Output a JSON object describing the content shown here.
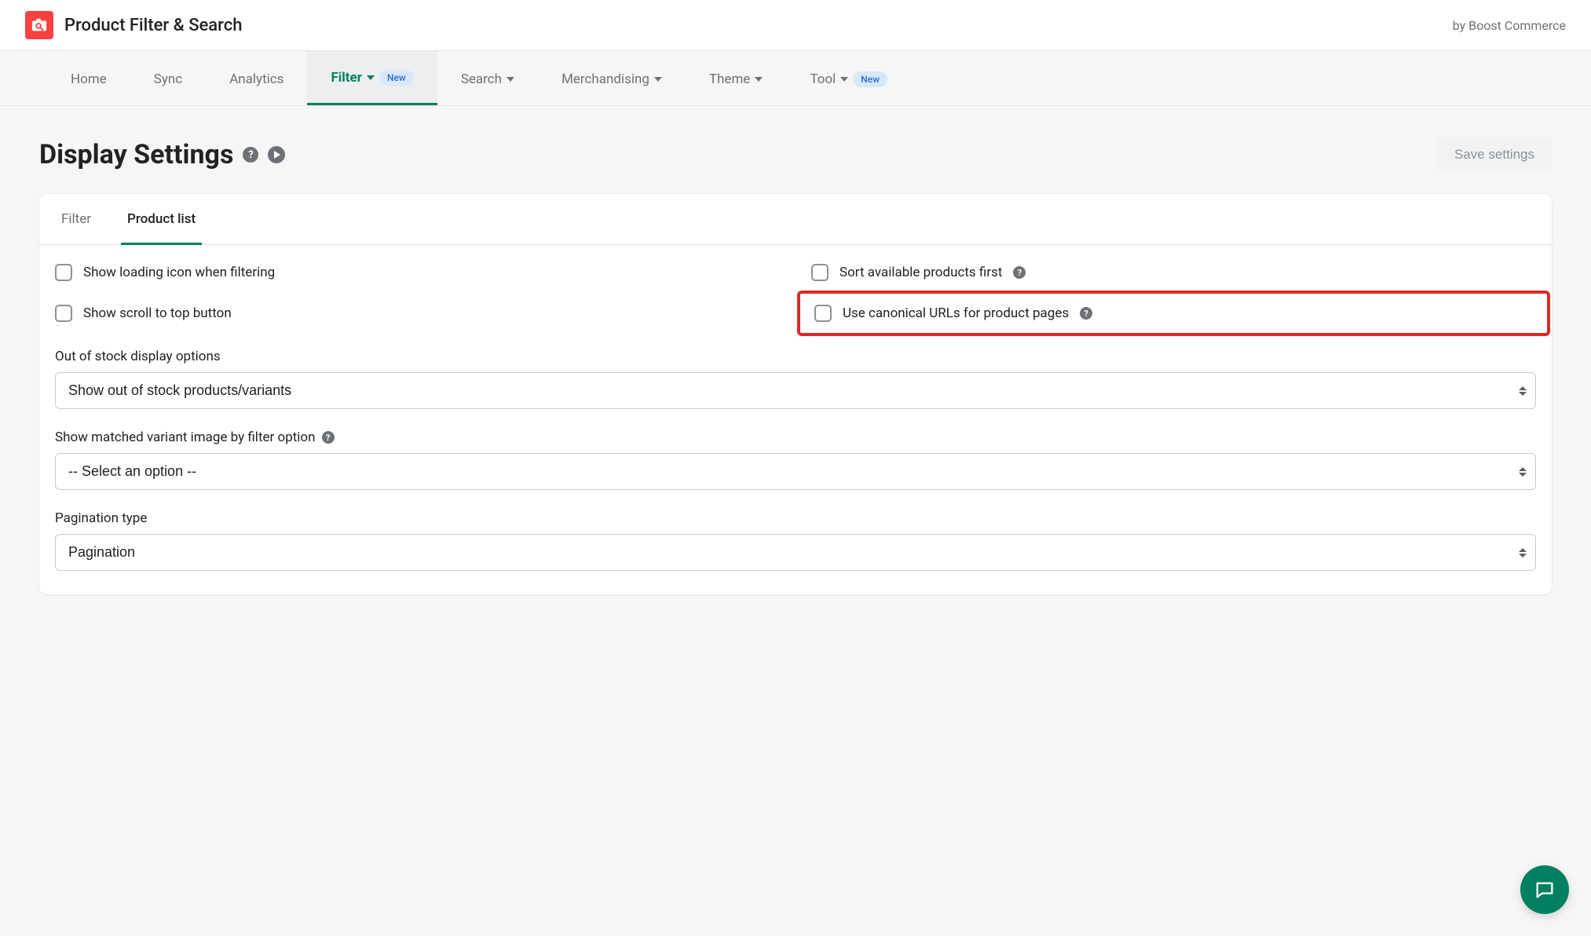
{
  "header": {
    "app_title": "Product Filter & Search",
    "by_line": "by Boost Commerce"
  },
  "nav": {
    "items": [
      {
        "label": "Home",
        "caret": false
      },
      {
        "label": "Sync",
        "caret": false
      },
      {
        "label": "Analytics",
        "caret": false
      },
      {
        "label": "Filter",
        "caret": true,
        "badge": "New",
        "active": true
      },
      {
        "label": "Search",
        "caret": true
      },
      {
        "label": "Merchandising",
        "caret": true
      },
      {
        "label": "Theme",
        "caret": true
      },
      {
        "label": "Tool",
        "caret": true,
        "badge": "New"
      }
    ]
  },
  "page": {
    "title": "Display Settings",
    "save_label": "Save settings"
  },
  "tabs": {
    "filter": "Filter",
    "product_list": "Product list"
  },
  "checks": {
    "loading_icon": "Show loading icon when filtering",
    "sort_available": "Sort available products first",
    "scroll_top": "Show scroll to top button",
    "canonical": "Use canonical URLs for product pages"
  },
  "form": {
    "oos_label": "Out of stock display options",
    "oos_value": "Show out of stock products/variants",
    "variant_label": "Show matched variant image by filter option",
    "variant_value": "-- Select an option --",
    "pagination_label": "Pagination type",
    "pagination_value": "Pagination"
  }
}
